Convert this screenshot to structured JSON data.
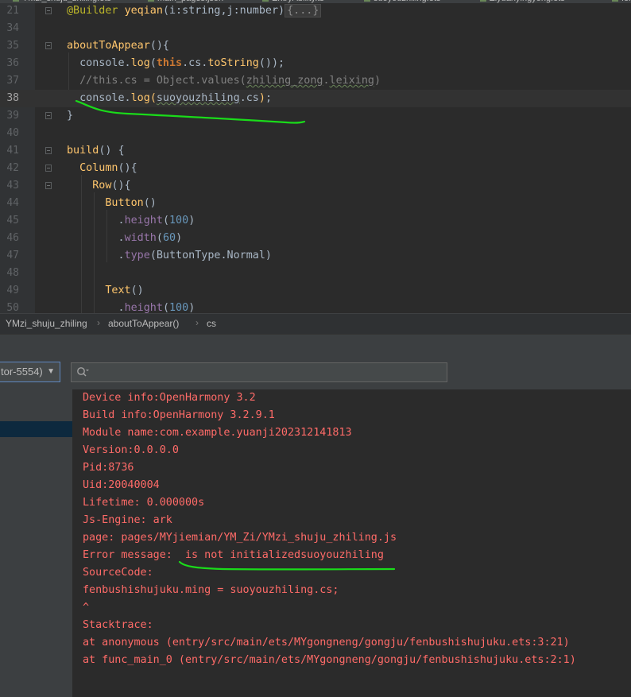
{
  "editor": {
    "lines": [
      {
        "num": "21",
        "segments": [
          {
            "t": "@Builder ",
            "c": "dec"
          },
          {
            "t": "yeqian",
            "c": "fn"
          },
          {
            "t": "(i:string,j:number)",
            "c": ""
          },
          {
            "t": "{...}",
            "c": "collapsed"
          }
        ]
      },
      {
        "num": "34",
        "segments": []
      },
      {
        "num": "35",
        "segments": [
          {
            "t": "aboutToAppear",
            "c": "fn"
          },
          {
            "t": "(){",
            "c": ""
          }
        ]
      },
      {
        "num": "36",
        "segments": [
          {
            "t": "  console.",
            "c": ""
          },
          {
            "t": "log",
            "c": "fn"
          },
          {
            "t": "(",
            "c": ""
          },
          {
            "t": "this",
            "c": "kw"
          },
          {
            "t": ".cs.",
            "c": ""
          },
          {
            "t": "toString",
            "c": "fn"
          },
          {
            "t": "());",
            "c": ""
          }
        ]
      },
      {
        "num": "37",
        "segments": [
          {
            "t": "  //this.cs = Object.values(",
            "c": "cm"
          },
          {
            "t": "zhiling_zong",
            "c": "cm squig"
          },
          {
            "t": ".",
            "c": "cm"
          },
          {
            "t": "leixing",
            "c": "cm squig"
          },
          {
            "t": ")",
            "c": "cm"
          }
        ]
      },
      {
        "num": "38",
        "segments": [
          {
            "t": "  console.",
            "c": ""
          },
          {
            "t": "log",
            "c": "fn"
          },
          {
            "t": "(",
            "c": "fn"
          },
          {
            "t": "suoyouzhiling",
            "c": "squig"
          },
          {
            "t": ".cs",
            "c": ""
          },
          {
            "t": ")",
            "c": "fn"
          },
          {
            "t": ";",
            "c": ""
          }
        ]
      },
      {
        "num": "39",
        "segments": [
          {
            "t": "}",
            "c": ""
          }
        ]
      },
      {
        "num": "40",
        "segments": []
      },
      {
        "num": "41",
        "segments": [
          {
            "t": "build",
            "c": "fn"
          },
          {
            "t": "() {",
            "c": ""
          }
        ]
      },
      {
        "num": "42",
        "segments": [
          {
            "t": "  ",
            "c": ""
          },
          {
            "t": "Column",
            "c": "fn"
          },
          {
            "t": "(){",
            "c": ""
          }
        ]
      },
      {
        "num": "43",
        "segments": [
          {
            "t": "    ",
            "c": ""
          },
          {
            "t": "Row",
            "c": "fn"
          },
          {
            "t": "(){",
            "c": ""
          }
        ]
      },
      {
        "num": "44",
        "segments": [
          {
            "t": "      ",
            "c": ""
          },
          {
            "t": "Button",
            "c": "fn"
          },
          {
            "t": "()",
            "c": ""
          }
        ]
      },
      {
        "num": "45",
        "segments": [
          {
            "t": "        .",
            "c": ""
          },
          {
            "t": "height",
            "c": "prop"
          },
          {
            "t": "(",
            "c": ""
          },
          {
            "t": "100",
            "c": "num"
          },
          {
            "t": ")",
            "c": ""
          }
        ]
      },
      {
        "num": "46",
        "segments": [
          {
            "t": "        .",
            "c": ""
          },
          {
            "t": "width",
            "c": "prop"
          },
          {
            "t": "(",
            "c": ""
          },
          {
            "t": "60",
            "c": "num"
          },
          {
            "t": ")",
            "c": ""
          }
        ]
      },
      {
        "num": "47",
        "segments": [
          {
            "t": "        .",
            "c": ""
          },
          {
            "t": "type",
            "c": "prop"
          },
          {
            "t": "(ButtonType.Normal)",
            "c": ""
          }
        ]
      },
      {
        "num": "48",
        "segments": []
      },
      {
        "num": "49",
        "segments": [
          {
            "t": "      ",
            "c": ""
          },
          {
            "t": "Text",
            "c": "fn"
          },
          {
            "t": "()",
            "c": ""
          }
        ]
      },
      {
        "num": "50",
        "segments": [
          {
            "t": "        .",
            "c": ""
          },
          {
            "t": "height",
            "c": "prop"
          },
          {
            "t": "(",
            "c": ""
          },
          {
            "t": "100",
            "c": "num"
          },
          {
            "t": ")",
            "c": ""
          }
        ]
      }
    ],
    "current_line": "38"
  },
  "tabs": [
    {
      "label": "YMzi_shuju_zhiling.ets"
    },
    {
      "label": "main_pages.json"
    },
    {
      "label": "EntryAbility.ts"
    },
    {
      "label": "suoyouzhiling.ets"
    },
    {
      "label": "Ziyuanyingyong.ets"
    },
    {
      "label": "fen"
    }
  ],
  "breadcrumb": {
    "items": [
      "YMzi_shuju_zhiling",
      "aboutToAppear()",
      "cs"
    ]
  },
  "toolbar": {
    "device_select_value": "tor-5554)",
    "search_placeholder": "",
    "search_icon": "search-icon"
  },
  "log": {
    "lines": [
      "Device info:OpenHarmony 3.2",
      "Build info:OpenHarmony 3.2.9.1",
      "Module name:com.example.yuanji202312141813",
      "Version:0.0.0.0",
      "Pid:8736",
      "Uid:20040004",
      "Lifetime: 0.000000s",
      "Js-Engine: ark",
      "page: pages/MYjiemian/YM_Zi/YMzi_shuju_zhiling.js",
      "Error message:  is not initializedsuoyouzhiling",
      "SourceCode:",
      "fenbushishujuku.ming = suoyouzhiling.cs;",
      "^",
      "Stacktrace:",
      "at anonymous (entry/src/main/ets/MYgongneng/gongju/fenbushishujuku.ets:3:21)",
      "at func_main_0 (entry/src/main/ets/MYgongneng/gongju/fenbushishujuku.ets:2:1)"
    ],
    "color": "#ff6b68"
  },
  "annotation_color": "#1adb1a"
}
